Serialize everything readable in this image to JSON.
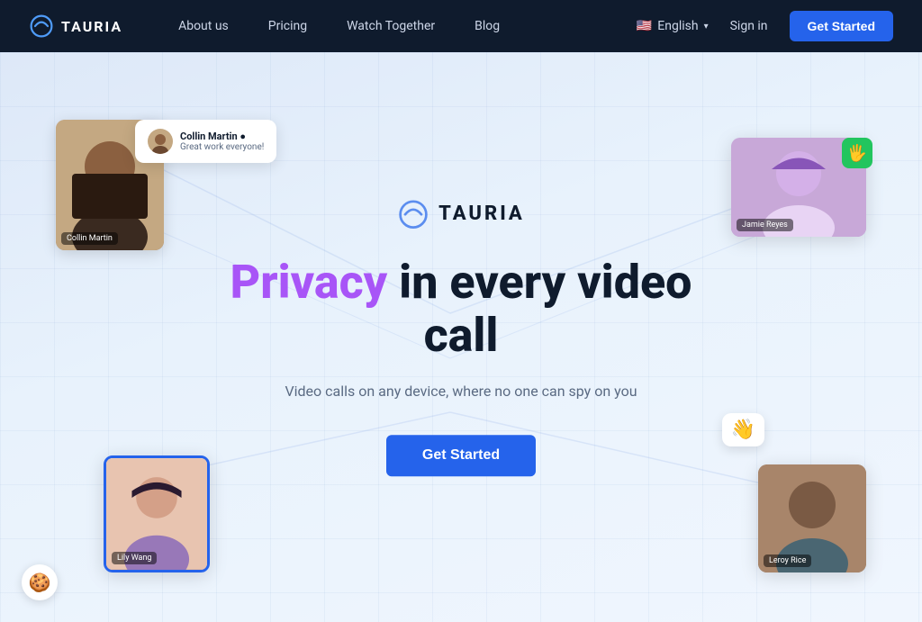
{
  "nav": {
    "logo_text": "TAURIA",
    "links": [
      {
        "label": "About us",
        "id": "about-us"
      },
      {
        "label": "Pricing",
        "id": "pricing"
      },
      {
        "label": "Watch Together",
        "id": "watch-together"
      },
      {
        "label": "Blog",
        "id": "blog"
      }
    ],
    "language": "English",
    "lang_flag": "🇺🇸",
    "signin_label": "Sign in",
    "cta_label": "Get Started"
  },
  "hero": {
    "brand_text": "TAURIA",
    "headline_prefix": "Privacy",
    "headline_suffix": " in every video call",
    "subtext": "Video calls on any device, where no one can spy on you",
    "cta_label": "Get Started",
    "cards": [
      {
        "id": "collin",
        "name": "Collin Martin",
        "name_tag": "Collin Martin"
      },
      {
        "id": "jamie",
        "name": "Jamie Reyes",
        "name_tag": "Jamie Reyes"
      },
      {
        "id": "lily",
        "name": "Lily Wang",
        "name_tag": "Lily Wang"
      },
      {
        "id": "leroy",
        "name": "Leroy Rice",
        "name_tag": "Leroy Rice"
      }
    ],
    "bubble": {
      "name": "Collin Martin ●",
      "message": "Great work everyone!"
    },
    "wave_emoji": "👋",
    "hand_icon": "🖐️"
  },
  "cookie": {
    "icon": "🍪"
  }
}
